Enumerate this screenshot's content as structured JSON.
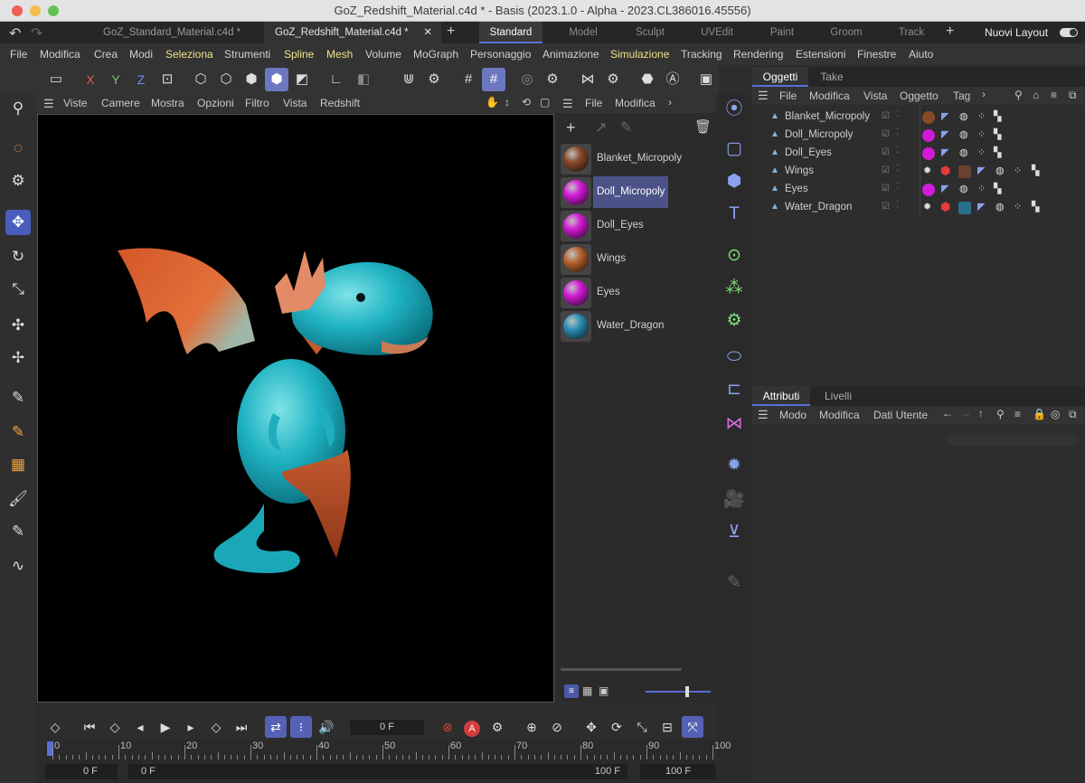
{
  "window": {
    "title": "GoZ_Redshift_Material.c4d * - Basis (2023.1.0 - Alpha - 2023.CL386016.45556)"
  },
  "file_tabs": [
    {
      "label": "GoZ_Standard_Material.c4d *"
    },
    {
      "label": "GoZ_Redshift_Material.c4d *"
    }
  ],
  "layout_tabs": [
    "Standard",
    "Model",
    "Sculpt",
    "UVEdit",
    "Paint",
    "Groom",
    "Track"
  ],
  "layout_switch": {
    "label": "Nuovi Layout"
  },
  "menu": [
    "File",
    "Modifica",
    "Crea",
    "Modi",
    "Seleziona",
    "Strumenti",
    "Spline",
    "Mesh",
    "Volume",
    "MoGraph",
    "Personaggio",
    "Animazione",
    "Simulazione",
    "Tracking",
    "Rendering",
    "Estensioni",
    "Finestre",
    "Aiuto"
  ],
  "axis_buttons": [
    "X",
    "Y",
    "Z"
  ],
  "viewport_menu": [
    "Viste",
    "Camere",
    "Mostra",
    "Opzioni",
    "Filtro",
    "Vista",
    "Redshift"
  ],
  "material_menu": [
    "File",
    "Modifica"
  ],
  "materials": [
    {
      "name": "Blanket_Micropoly",
      "color": "#8a4a28"
    },
    {
      "name": "Doll_Micropoly",
      "color": "#d21bd6"
    },
    {
      "name": "Doll_Eyes",
      "color": "#d21bd6"
    },
    {
      "name": "Wings",
      "color": "#b5632f"
    },
    {
      "name": "Eyes",
      "color": "#d21bd6"
    },
    {
      "name": "Water_Dragon",
      "color": "#2a8fb5"
    }
  ],
  "object_tabs": [
    "Oggetti",
    "Take"
  ],
  "object_menu": [
    "File",
    "Modifica",
    "Vista",
    "Oggetto",
    "Tag"
  ],
  "objects": [
    {
      "name": "Blanket_Micropoly"
    },
    {
      "name": "Doll_Micropoly"
    },
    {
      "name": "Doll_Eyes"
    },
    {
      "name": "Wings"
    },
    {
      "name": "Eyes"
    },
    {
      "name": "Water_Dragon"
    }
  ],
  "attr_tabs": [
    "Attributi",
    "Livelli"
  ],
  "attr_menu": [
    "Modo",
    "Modifica",
    "Dati Utente"
  ],
  "timeline": {
    "current_frame": "0 F",
    "ruler_ticks": [
      "0",
      "10",
      "20",
      "30",
      "40",
      "50",
      "60",
      "70",
      "80",
      "90",
      "100"
    ],
    "range_start": "0 F",
    "range_inner_start": "0 F",
    "range_inner_end": "100 F",
    "range_end": "100 F"
  }
}
